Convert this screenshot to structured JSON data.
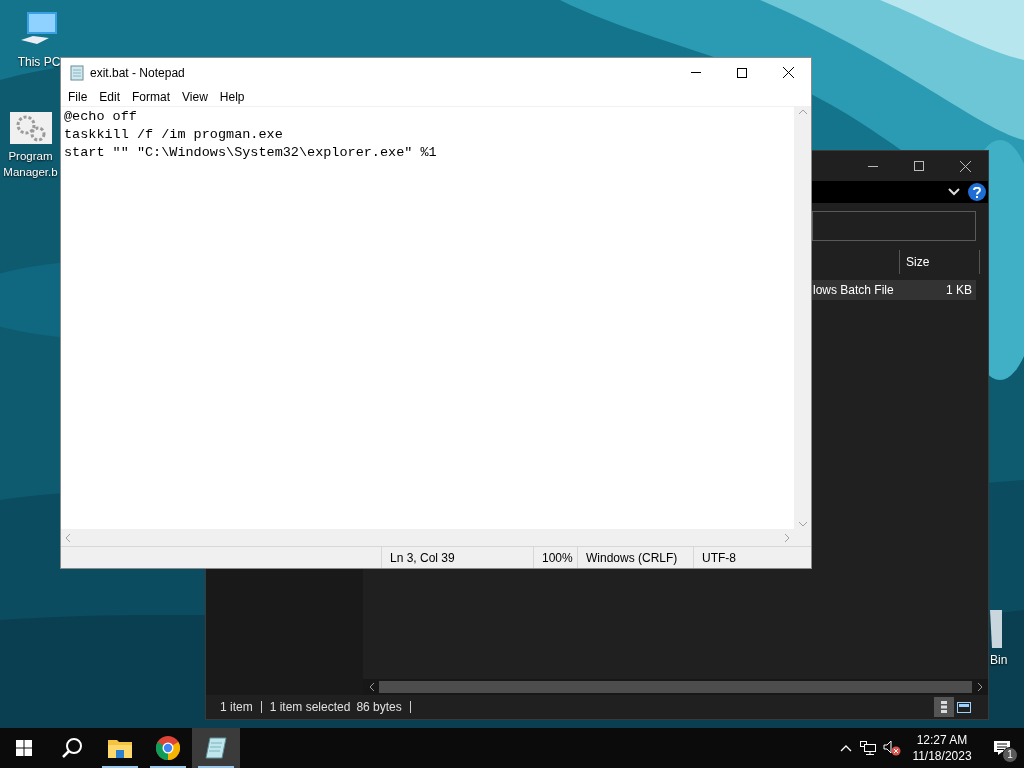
{
  "desktop_icons": [
    {
      "kind": "computer",
      "label": "This PC"
    },
    {
      "kind": "gears",
      "label": "Program Manager.b"
    },
    {
      "kind": "recycle",
      "label": "Bin"
    }
  ],
  "explorer": {
    "columns": [
      "Size"
    ],
    "rows": [
      {
        "type": "lows Batch File",
        "size": "1 KB",
        "selected": true
      }
    ],
    "status": [
      "1 item",
      "1 item selected",
      "86 bytes"
    ],
    "views": [
      {
        "kind": "details",
        "selected": true
      },
      {
        "kind": "tiles",
        "selected": false
      }
    ]
  },
  "notepad": {
    "title": "exit.bat - Notepad",
    "menu": [
      "File",
      "Edit",
      "Format",
      "View",
      "Help"
    ],
    "lines": [
      "@echo off",
      "taskkill /f /im progman.exe",
      "start \"\" \"C:\\Windows\\System32\\explorer.exe\" %1"
    ],
    "status": [
      "Ln 3, Col 39",
      "100%",
      "Windows (CRLF)",
      "UTF-8"
    ]
  },
  "taskbar": {
    "apps": [
      {
        "kind": "explorer",
        "running": true,
        "selected": false
      },
      {
        "kind": "chrome",
        "running": true,
        "selected": false
      },
      {
        "kind": "notepad",
        "running": true,
        "selected": true
      }
    ],
    "time": "12:27 AM",
    "date": "11/18/2023",
    "notifications": "1"
  }
}
